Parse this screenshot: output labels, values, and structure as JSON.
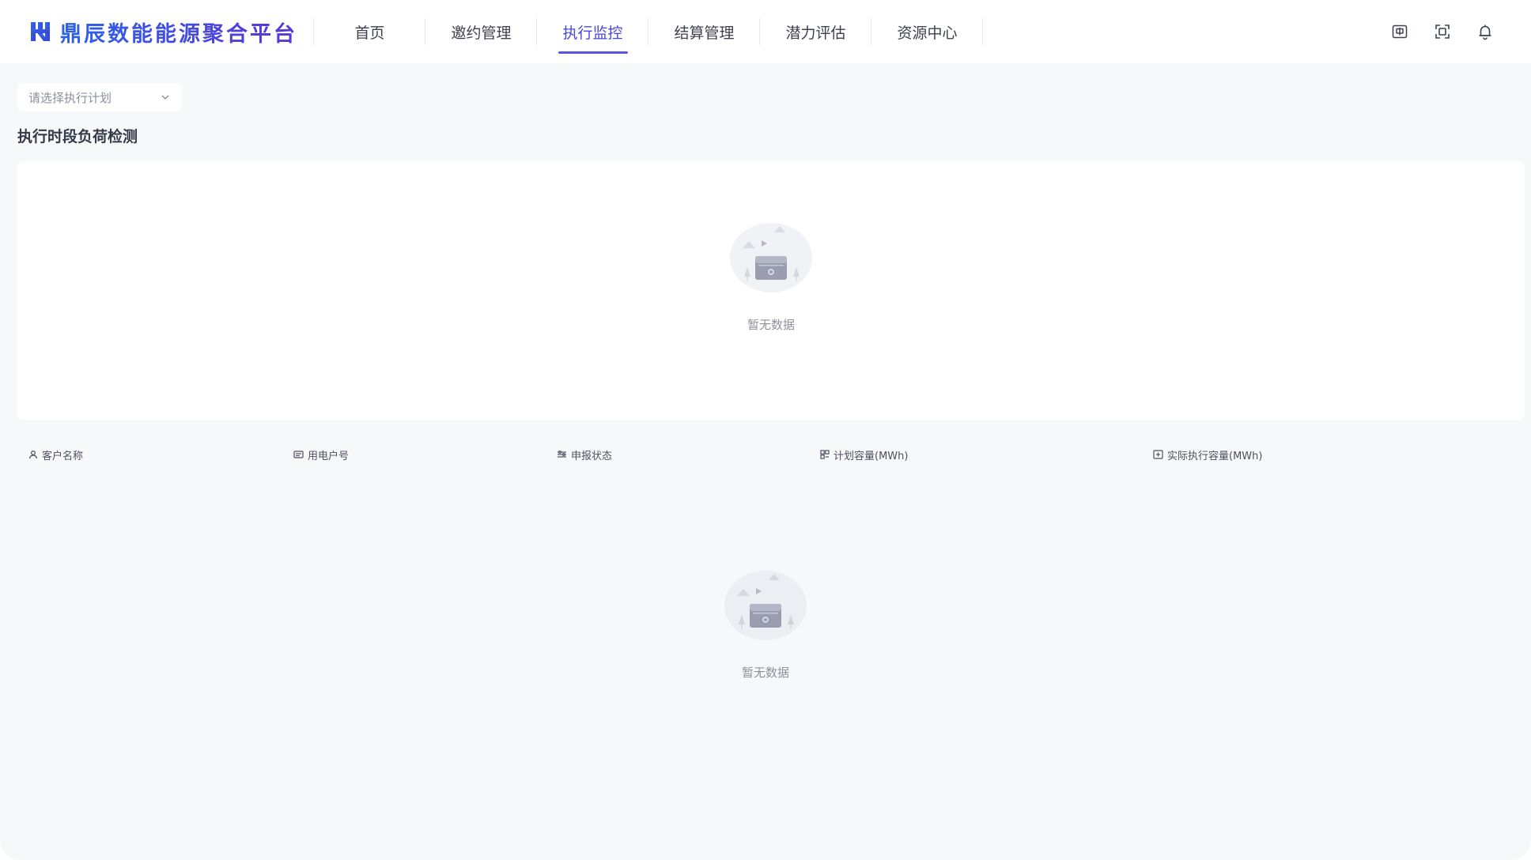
{
  "app": {
    "title": "鼎辰数能能源聚合平台",
    "brand_color": "#3a45d6",
    "accent_color": "#5b55e0"
  },
  "nav": {
    "items": [
      {
        "label": "首页",
        "active": false
      },
      {
        "label": "邀约管理",
        "active": false
      },
      {
        "label": "执行监控",
        "active": true
      },
      {
        "label": "结算管理",
        "active": false
      },
      {
        "label": "潜力评估",
        "active": false
      },
      {
        "label": "资源中心",
        "active": false
      }
    ]
  },
  "header_actions": {
    "icons": [
      "language-icon",
      "fullscreen-icon",
      "bell-icon"
    ]
  },
  "filters": {
    "plan_select_placeholder": "请选择执行计划"
  },
  "section": {
    "title": "执行时段负荷检测"
  },
  "chart_panel": {
    "empty_text": "暂无数据"
  },
  "table": {
    "columns": [
      {
        "label": "客户名称",
        "icon": "user-icon"
      },
      {
        "label": "用电户号",
        "icon": "id-card-icon"
      },
      {
        "label": "申报状态",
        "icon": "sliders-icon"
      },
      {
        "label": "计划容量(MWh)",
        "icon": "grid-icon"
      },
      {
        "label": "实际执行容量(MWh)",
        "icon": "capacity-icon"
      }
    ],
    "rows": [],
    "empty_text": "暂无数据"
  }
}
